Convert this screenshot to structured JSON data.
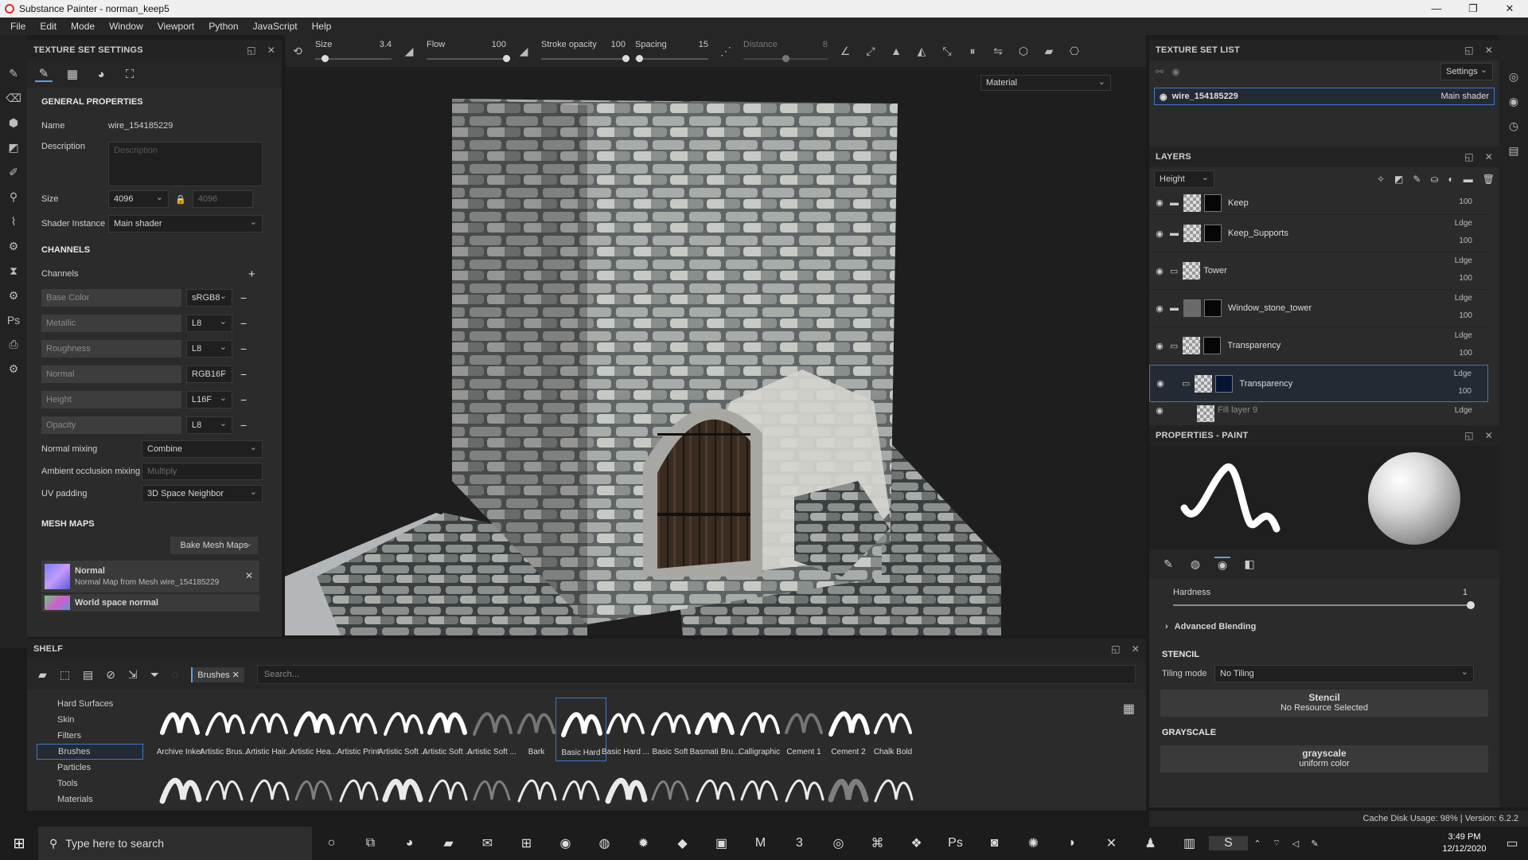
{
  "window": {
    "title": "Substance Painter - norman_keep5",
    "minimize": "—",
    "restore": "❐",
    "close": "✕"
  },
  "menu": [
    "File",
    "Edit",
    "Mode",
    "Window",
    "Viewport",
    "Python",
    "JavaScript",
    "Help"
  ],
  "texture_set_settings": {
    "header": "TEXTURE SET SETTINGS",
    "general_title": "GENERAL PROPERTIES",
    "name_label": "Name",
    "name_value": "wire_154185229",
    "description_label": "Description",
    "description_placeholder": "Description",
    "size_label": "Size",
    "size_value": "4096",
    "size_locked_value": "4096",
    "shader_label": "Shader Instance",
    "shader_value": "Main shader",
    "channels_title": "CHANNELS",
    "channels_label": "Channels",
    "channels": [
      {
        "name": "Base Color",
        "format": "sRGB8"
      },
      {
        "name": "Metallic",
        "format": "L8"
      },
      {
        "name": "Roughness",
        "format": "L8"
      },
      {
        "name": "Normal",
        "format": "RGB16F"
      },
      {
        "name": "Height",
        "format": "L16F"
      },
      {
        "name": "Opacity",
        "format": "L8"
      }
    ],
    "normal_mixing_label": "Normal mixing",
    "normal_mixing_value": "Combine",
    "ao_mixing_label": "Ambient occlusion mixing",
    "ao_mixing_value": "Multiply",
    "uv_padding_label": "UV padding",
    "uv_padding_value": "3D Space Neighbor",
    "mesh_maps_title": "MESH MAPS",
    "bake_button": "Bake Mesh Maps",
    "mesh_maps": [
      {
        "name": "Normal",
        "desc": "Normal Map from Mesh wire_154185229"
      },
      {
        "name": "World space normal",
        "desc": ""
      }
    ]
  },
  "tool_options": {
    "size_label": "Size",
    "size_value": "3.4",
    "size_fraction": 0.12,
    "flow_label": "Flow",
    "flow_value": "100",
    "flow_fraction": 1.0,
    "opacity_label": "Stroke opacity",
    "opacity_value": "100",
    "opacity_fraction": 1.0,
    "spacing_label": "Spacing",
    "spacing_value": "15",
    "spacing_fraction": 0.05,
    "distance_label": "Distance",
    "distance_value": "8",
    "distance_fraction": 0.5
  },
  "viewport": {
    "display_mode": "Material"
  },
  "texture_set_list": {
    "header": "TEXTURE SET LIST",
    "settings_button": "Settings",
    "item_name": "wire_154185229",
    "item_shader": "Main shader"
  },
  "layers": {
    "header": "LAYERS",
    "channel_select": "Height",
    "items": [
      {
        "name": "Keep",
        "blend": "",
        "opacity": "100"
      },
      {
        "name": "Keep_Supports",
        "blend": "Ldge",
        "opacity": "100"
      },
      {
        "name": "Tower",
        "blend": "Ldge",
        "opacity": "100"
      },
      {
        "name": "Window_stone_tower",
        "blend": "Ldge",
        "opacity": "100"
      },
      {
        "name": "Transparency",
        "blend": "Ldge",
        "opacity": "100"
      },
      {
        "name": "Transparency",
        "blend": "Ldge",
        "opacity": "100"
      },
      {
        "name": "Fill layer 9",
        "blend": "Ldge",
        "opacity": ""
      }
    ]
  },
  "properties": {
    "header": "PROPERTIES - PAINT",
    "hardness_label": "Hardness",
    "hardness_value": "1",
    "hardness_fraction": 1.0,
    "advanced_blending": "Advanced Blending",
    "stencil_title": "STENCIL",
    "tiling_label": "Tiling mode",
    "tiling_value": "No Tiling",
    "stencil_button": "Stencil",
    "stencil_sub": "No Resource Selected",
    "grayscale_title": "GRAYSCALE",
    "grayscale_button": "grayscale",
    "grayscale_sub": "uniform color"
  },
  "shelf": {
    "header": "SHELF",
    "filter_chip": "Brushes",
    "search_placeholder": "Search...",
    "categories": [
      "Hard Surfaces",
      "Skin",
      "Filters",
      "Brushes",
      "Particles",
      "Tools",
      "Materials"
    ],
    "active_category": "Brushes",
    "brushes": [
      "Archive Inker",
      "Artistic Brus...",
      "Artistic Hair...",
      "Artistic Hea...",
      "Artistic Print",
      "Artistic Soft ...",
      "Artistic Soft ...",
      "Artistic Soft ...",
      "Bark",
      "Basic Hard",
      "Basic Hard ...",
      "Basic Soft",
      "Basmati Bru...",
      "Calligraphic",
      "Cement 1",
      "Cement 2",
      "Chalk Bold"
    ],
    "active_brush": "Basic Hard"
  },
  "status": {
    "text": "Cache Disk Usage:  98% | Version: 6.2.2"
  },
  "taskbar": {
    "search_placeholder": "Type here to search",
    "time": "3:49 PM",
    "date": "12/12/2020"
  },
  "colors": {
    "accent": "#5aa0e6",
    "selection": "#3c78c8",
    "panel": "#2b2b2b"
  }
}
